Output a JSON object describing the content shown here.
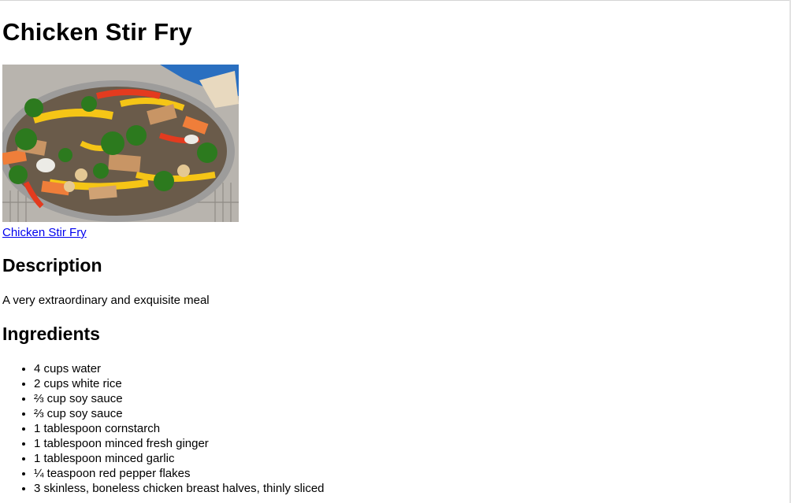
{
  "recipe": {
    "title": "Chicken Stir Fry",
    "image_link_text": "Chicken Stir Fry",
    "description_heading": "Description",
    "description": "A very extraordinary and exquisite meal",
    "ingredients_heading": "Ingredients",
    "ingredients": [
      "4 cups water",
      "2 cups white rice",
      "⅔ cup soy sauce",
      "⅔ cup soy sauce",
      "1 tablespoon cornstarch",
      "1 tablespoon minced fresh ginger",
      "1 tablespoon minced garlic",
      "¼ teaspoon red pepper flakes",
      "3 skinless, boneless chicken breast halves, thinly sliced"
    ]
  }
}
